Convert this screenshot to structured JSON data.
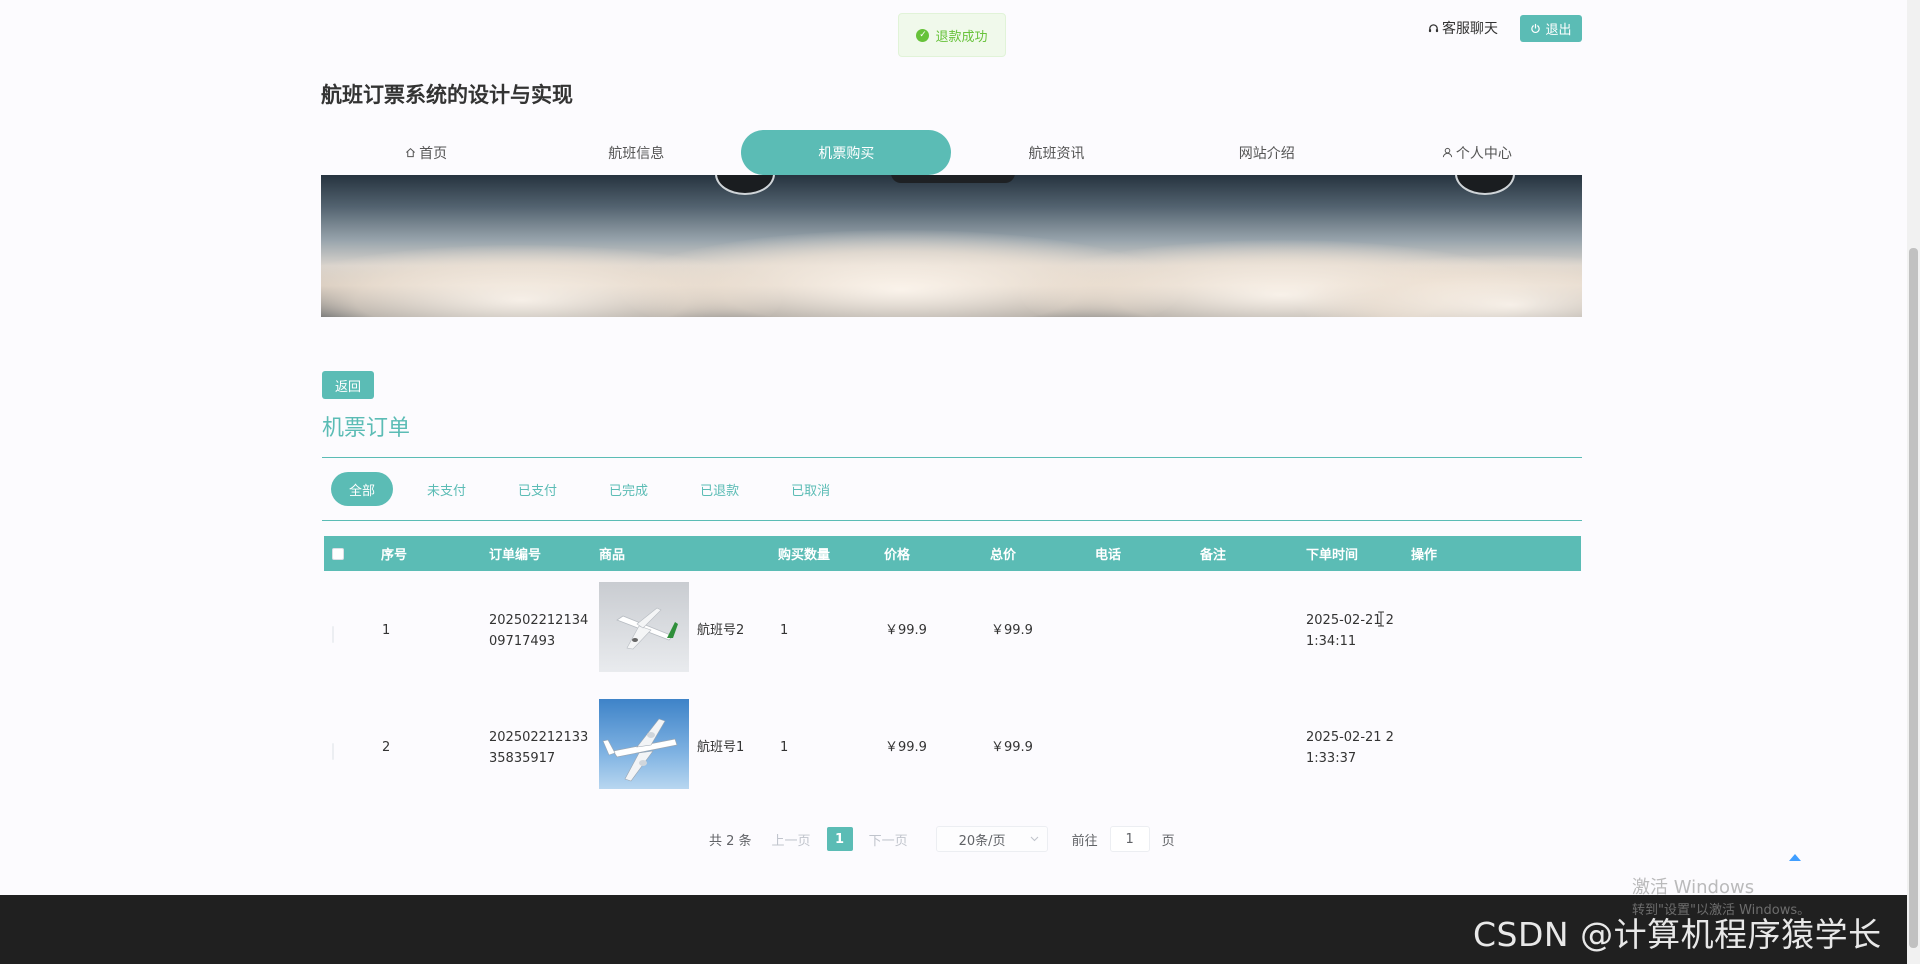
{
  "toast": {
    "message": "退款成功",
    "icon": "check-circle-icon",
    "color": "#67c23a"
  },
  "topbar": {
    "chat_label": "客服聊天",
    "logout_label": "退出"
  },
  "site": {
    "title": "航班订票系统的设计与实现"
  },
  "nav": {
    "items": [
      {
        "label": "首页",
        "icon": "home-icon"
      },
      {
        "label": "航班信息"
      },
      {
        "label": "机票购买",
        "active": true
      },
      {
        "label": "航班资讯"
      },
      {
        "label": "网站介绍"
      },
      {
        "label": "个人中心",
        "icon": "user-icon"
      }
    ]
  },
  "page": {
    "back_label": "返回",
    "section_title": "机票订单",
    "accent": "#5bbcb5"
  },
  "tabs": [
    "全部",
    "未支付",
    "已支付",
    "已完成",
    "已退款",
    "已取消"
  ],
  "table": {
    "headers": [
      "序号",
      "订单编号",
      "商品",
      "购买数量",
      "价格",
      "总价",
      "电话",
      "备注",
      "下单时间",
      "操作"
    ],
    "rows": [
      {
        "index": "1",
        "order_no_1": "202502212134",
        "order_no_2": "09717493",
        "product": "航班号2",
        "quantity": "1",
        "price": "￥99.9",
        "total": "￥99.9",
        "phone": "",
        "note": "",
        "time_1": "2025-02-21 2",
        "time_2": "1:34:11"
      },
      {
        "index": "2",
        "order_no_1": "202502212133",
        "order_no_2": "35835917",
        "product": "航班号1",
        "quantity": "1",
        "price": "￥99.9",
        "total": "￥99.9",
        "phone": "",
        "note": "",
        "time_1": "2025-02-21 2",
        "time_2": "1:33:37"
      }
    ]
  },
  "pagination": {
    "total_text": "共 2 条",
    "prev_label": "上一页",
    "current_page": "1",
    "next_label": "下一页",
    "page_size": "20条/页",
    "goto_label": "前往",
    "goto_value": "1",
    "page_unit": "页"
  },
  "watermarks": {
    "activate_title": "激活 Windows",
    "activate_sub": "转到\"设置\"以激活 Windows。",
    "csdn": "CSDN @计算机程序猿学长"
  }
}
